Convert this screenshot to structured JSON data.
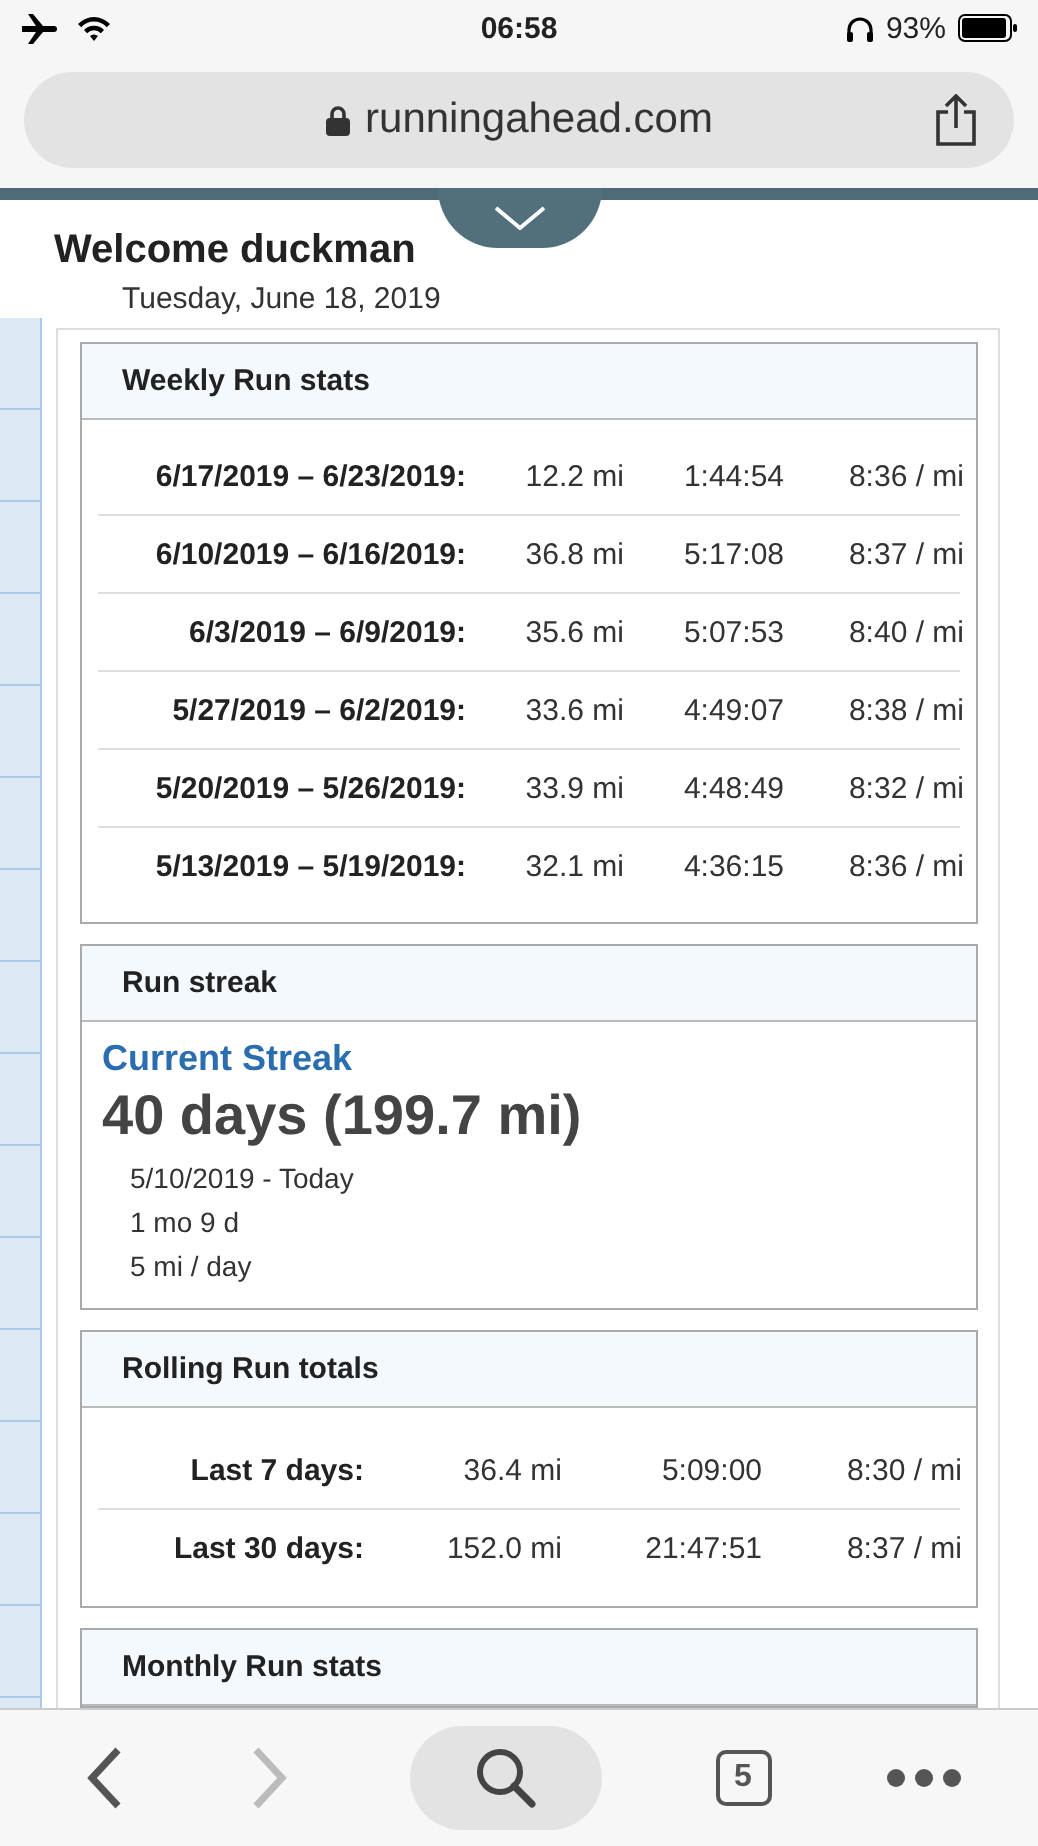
{
  "status_bar": {
    "time": "06:58",
    "battery": "93%"
  },
  "address_bar": {
    "url": "runningahead.com"
  },
  "page": {
    "title": "Welcome duckman",
    "date": "Tuesday, June 18, 2019"
  },
  "weekly": {
    "title": "Weekly Run stats",
    "rows": [
      {
        "period": "6/17/2019 – 6/23/2019:",
        "distance": "12.2 mi",
        "time": "1:44:54",
        "pace": "8:36 / mi"
      },
      {
        "period": "6/10/2019 – 6/16/2019:",
        "distance": "36.8 mi",
        "time": "5:17:08",
        "pace": "8:37 / mi"
      },
      {
        "period": "6/3/2019 – 6/9/2019:",
        "distance": "35.6 mi",
        "time": "5:07:53",
        "pace": "8:40 / mi"
      },
      {
        "period": "5/27/2019 – 6/2/2019:",
        "distance": "33.6 mi",
        "time": "4:49:07",
        "pace": "8:38 / mi"
      },
      {
        "period": "5/20/2019 – 5/26/2019:",
        "distance": "33.9 mi",
        "time": "4:48:49",
        "pace": "8:32 / mi"
      },
      {
        "period": "5/13/2019 – 5/19/2019:",
        "distance": "32.1 mi",
        "time": "4:36:15",
        "pace": "8:36 / mi"
      }
    ]
  },
  "streak": {
    "title": "Run streak",
    "label": "Current Streak",
    "value": "40 days (199.7 mi)",
    "details": [
      "5/10/2019 - Today",
      "1 mo 9 d",
      "5 mi / day"
    ]
  },
  "rolling": {
    "title": "Rolling Run totals",
    "rows": [
      {
        "period": "Last 7 days:",
        "distance": "36.4 mi",
        "time": "5:09:00",
        "pace": "8:30 / mi"
      },
      {
        "period": "Last 30 days:",
        "distance": "152.0 mi",
        "time": "21:47:51",
        "pace": "8:37 / mi"
      }
    ]
  },
  "monthly": {
    "title": "Monthly Run stats"
  },
  "toolbar": {
    "back": {
      "disabled": false
    },
    "forward": {
      "disabled": true
    },
    "tabs_count": "5"
  }
}
